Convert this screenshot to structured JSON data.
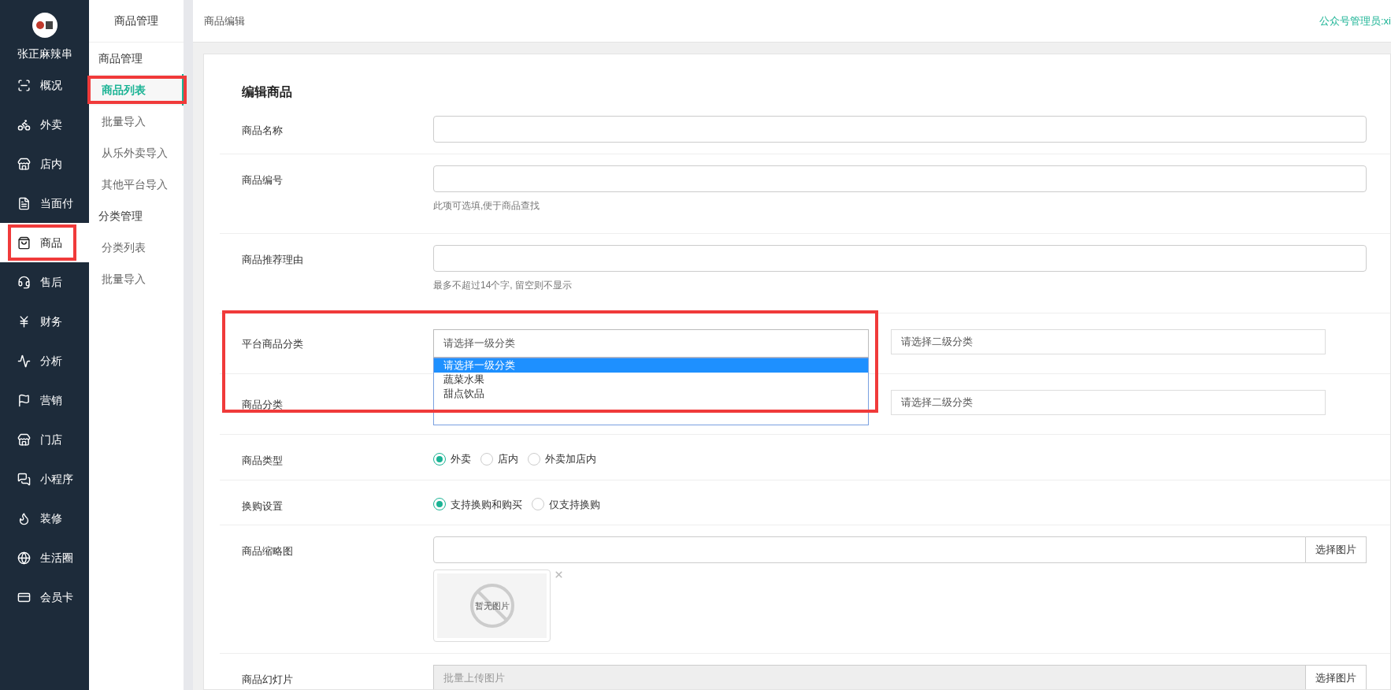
{
  "sidebar": {
    "brand": "张正麻辣串",
    "items": [
      {
        "label": "概况",
        "selected": false,
        "highlighted": false
      },
      {
        "label": "外卖",
        "selected": false,
        "highlighted": false
      },
      {
        "label": "店内",
        "selected": false,
        "highlighted": false
      },
      {
        "label": "当面付",
        "selected": false,
        "highlighted": false
      },
      {
        "label": "商品",
        "selected": true,
        "highlighted": true
      },
      {
        "label": "售后",
        "selected": false,
        "highlighted": false
      },
      {
        "label": "财务",
        "selected": false,
        "highlighted": false
      },
      {
        "label": "分析",
        "selected": false,
        "highlighted": false
      },
      {
        "label": "营销",
        "selected": false,
        "highlighted": false
      },
      {
        "label": "门店",
        "selected": false,
        "highlighted": false
      },
      {
        "label": "小程序",
        "selected": false,
        "highlighted": false
      },
      {
        "label": "装修",
        "selected": false,
        "highlighted": false
      },
      {
        "label": "生活圈",
        "selected": false,
        "highlighted": false
      },
      {
        "label": "会员卡",
        "selected": false,
        "highlighted": false
      }
    ]
  },
  "subnav": {
    "title": "商品管理",
    "groups": [
      {
        "heading": "商品管理",
        "items": [
          {
            "label": "商品列表",
            "selected": true,
            "highlighted": true
          },
          {
            "label": "批量导入",
            "selected": false,
            "highlighted": false
          },
          {
            "label": "从乐外卖导入",
            "selected": false,
            "highlighted": false
          },
          {
            "label": "其他平台导入",
            "selected": false,
            "highlighted": false
          }
        ]
      },
      {
        "heading": "分类管理",
        "items": [
          {
            "label": "分类列表",
            "selected": false,
            "highlighted": false
          },
          {
            "label": "批量导入",
            "selected": false,
            "highlighted": false
          }
        ]
      }
    ]
  },
  "header": {
    "title": "商品编辑",
    "user": "公众号管理员:xi"
  },
  "form": {
    "title": "编辑商品",
    "fields": [
      {
        "kind": "text",
        "label": "商品名称"
      },
      {
        "kind": "text",
        "label": "商品编号",
        "hint": "此项可选填,便于商品查找"
      },
      {
        "kind": "text",
        "label": "商品推荐理由",
        "hint": "最多不超过14个字, 留空则不显示"
      },
      {
        "kind": "category_group",
        "highlighted": true,
        "rows": [
          {
            "label": "平台商品分类",
            "primary": "请选择一级分类",
            "secondary": "请选择二级分类",
            "open": true,
            "options": [
              {
                "label": "请选择一级分类",
                "selected": true
              },
              {
                "label": "蔬菜水果",
                "selected": false
              },
              {
                "label": "甜点饮品",
                "selected": false
              }
            ]
          },
          {
            "label": "商品分类",
            "secondary": "请选择二级分类"
          }
        ]
      },
      {
        "kind": "radio",
        "label": "商品类型",
        "options": [
          {
            "label": "外卖",
            "selected": true
          },
          {
            "label": "店内",
            "selected": false
          },
          {
            "label": "外卖加店内",
            "selected": false
          }
        ]
      },
      {
        "kind": "radio",
        "label": "换购设置",
        "options": [
          {
            "label": "支持换购和购买",
            "selected": true
          },
          {
            "label": "仅支持换购",
            "selected": false
          }
        ]
      },
      {
        "kind": "image",
        "label": "商品缩略图",
        "button": "选择图片",
        "empty_text": "暂无图片"
      },
      {
        "kind": "upload",
        "label": "商品幻灯片",
        "placeholder": "批量上传图片",
        "button": "选择图片"
      }
    ]
  }
}
